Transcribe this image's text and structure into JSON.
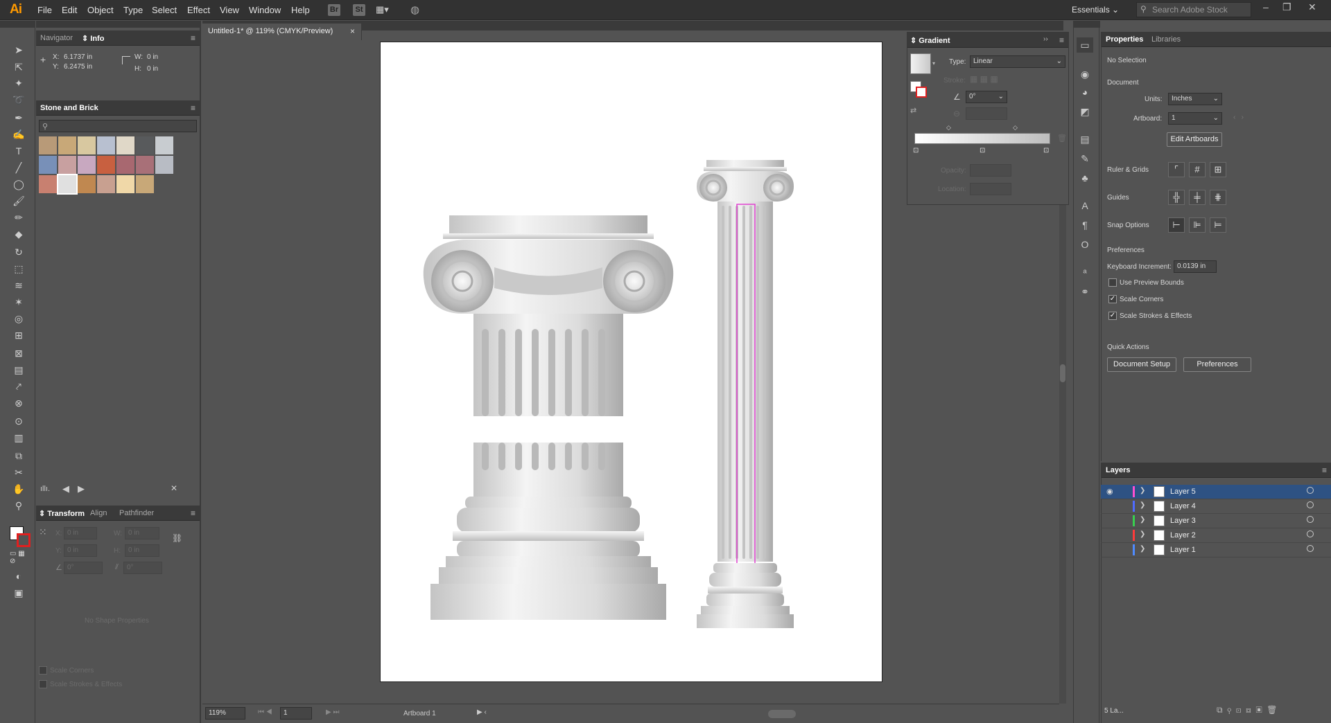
{
  "app": {
    "logo": "Ai",
    "workspace": "Essentials",
    "search_placeholder": "Search Adobe Stock"
  },
  "menu": [
    "File",
    "Edit",
    "Object",
    "Type",
    "Select",
    "Effect",
    "View",
    "Window",
    "Help"
  ],
  "bridge": {
    "br": "Br",
    "st": "St"
  },
  "colors": {
    "accent": "#ff9a00",
    "selection": "#2e5283",
    "canvas": "#ffffff",
    "pasteboard": "#535353"
  },
  "document_tab": {
    "title": "Untitled-1* @ 119% (CMYK/Preview)",
    "close": "×"
  },
  "info_panel": {
    "tabs": [
      "Navigator",
      "Info"
    ],
    "x_label": "X:",
    "x_value": "6.1737 in",
    "y_label": "Y:",
    "y_value": "6.2475 in",
    "w_label": "W:",
    "w_value": "0 in",
    "h_label": "H:",
    "h_value": "0 in"
  },
  "swatch_panel": {
    "title": "Stone and Brick",
    "swatches": [
      "#b89a78",
      "#c8a878",
      "#d8c8a0",
      "#b8c0d0",
      "#e0d8c8",
      "#585a5c",
      "#c8ccd0",
      "#7890b8",
      "#c8a0a0",
      "#c8a8c0",
      "#c86040",
      "#a86870",
      "#a87078",
      "#b8bcc4",
      "#c88070",
      "#e0e0e0",
      "#c08850",
      "#c8a090",
      "#f0d8a8",
      "#c8a878"
    ]
  },
  "transform_panel": {
    "tabs": [
      "Transform",
      "Align",
      "Pathfinder"
    ],
    "x_label": "X:",
    "x_value": "0 in",
    "w_label": "W:",
    "w_value": "0 in",
    "y_label": "Y:",
    "y_value": "0 in",
    "h_label": "H:",
    "h_value": "0 in",
    "angle_value": "0°",
    "shear_value": "0°",
    "no_shape": "No Shape Properties",
    "scale_corners": "Scale Corners",
    "scale_strokes": "Scale Strokes & Effects"
  },
  "gradient_panel": {
    "title": "Gradient",
    "type_label": "Type:",
    "type_value": "Linear",
    "stroke_label": "Stroke:",
    "angle_value": "0°",
    "opacity_label": "Opacity:",
    "location_label": "Location:"
  },
  "properties_panel": {
    "tabs": [
      "Properties",
      "Libraries"
    ],
    "no_selection": "No Selection",
    "document_label": "Document",
    "units_label": "Units:",
    "units_value": "Inches",
    "artboard_label": "Artboard:",
    "artboard_value": "1",
    "edit_artboards": "Edit Artboards",
    "ruler_grids": "Ruler & Grids",
    "guides": "Guides",
    "snap_options": "Snap Options",
    "preferences_label": "Preferences",
    "keyboard_increment_label": "Keyboard Increment:",
    "keyboard_increment_value": "0.0139 in",
    "use_preview_bounds": "Use Preview Bounds",
    "scale_corners": "Scale Corners",
    "scale_strokes": "Scale Strokes & Effects",
    "quick_actions": "Quick Actions",
    "document_setup": "Document Setup",
    "preferences_btn": "Preferences"
  },
  "layers_panel": {
    "title": "Layers",
    "layers": [
      {
        "name": "Layer 5",
        "color": "#ff4fd0"
      },
      {
        "name": "Layer 4",
        "color": "#4f6bff"
      },
      {
        "name": "Layer 3",
        "color": "#38d04f"
      },
      {
        "name": "Layer 2",
        "color": "#ff3b3b"
      },
      {
        "name": "Layer 1",
        "color": "#4f8bff"
      }
    ],
    "count_label": "5 La..."
  },
  "status_bar": {
    "zoom": "119%",
    "artboard_num": "1",
    "artboard_label": "Artboard 1"
  }
}
